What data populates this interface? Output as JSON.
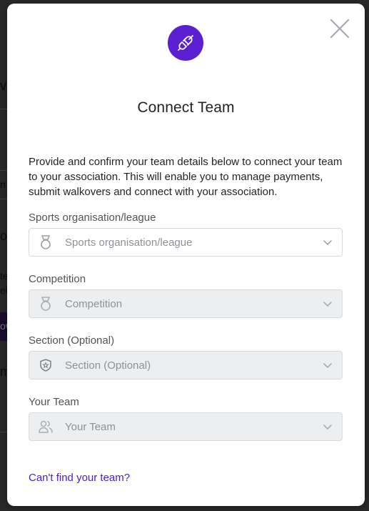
{
  "colors": {
    "accent": "#5b1fd1",
    "link": "#4b1cc8",
    "icon_gray": "#9ea2a6"
  },
  "background": {
    "fragments": [
      "v",
      "n",
      "o",
      "te",
      "eit",
      "ov",
      "m"
    ]
  },
  "modal": {
    "close_icon": "close-icon",
    "header_icon": "plug-icon",
    "title": "Connect Team",
    "description": "Provide and confirm your team details below to connect your team to your association. This will enable you to manage payments, submit walkovers and connect with your association.",
    "fields": [
      {
        "label": "Sports organisation/league",
        "placeholder": "Sports organisation/league",
        "icon": "medal-icon",
        "disabled": false
      },
      {
        "label": "Competition",
        "placeholder": "Competition",
        "icon": "medal-icon",
        "disabled": true
      },
      {
        "label": "Section (Optional)",
        "placeholder": "Section (Optional)",
        "icon": "shield-star-icon",
        "disabled": true
      },
      {
        "label": "Your Team",
        "placeholder": "Your Team",
        "icon": "team-users-icon",
        "disabled": true
      }
    ],
    "help_link": "Can't find your team?"
  }
}
